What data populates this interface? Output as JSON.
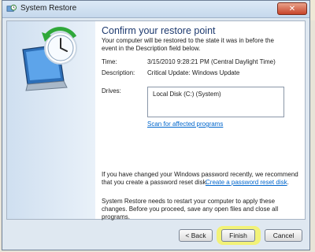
{
  "window": {
    "title": "System Restore",
    "close_glyph": "✕"
  },
  "page": {
    "heading": "Confirm your restore point",
    "intro": "Your computer will be restored to the state it was in before the event in the Description field below.",
    "time_label": "Time:",
    "time_value": "3/15/2010 9:28:21 PM (Central Daylight Time)",
    "description_label": "Description:",
    "description_value": "Critical Update: Windows Update",
    "drives_label": "Drives:",
    "drives": [
      "Local Disk (C:) (System)"
    ],
    "scan_link": "Scan for affected programs",
    "password_text": "If you have changed your Windows password recently, we recommend that you create a password reset disk.",
    "password_link": "Create a password reset disk",
    "password_end": ".",
    "restart_text": "System Restore needs to restart your computer to apply these changes. Before you proceed, save any open files and close all programs."
  },
  "buttons": {
    "back": "< Back",
    "finish": "Finish",
    "cancel": "Cancel"
  },
  "colors": {
    "accent_heading": "#1e3a6f",
    "link": "#0066cc",
    "highlight": "#f4f36a"
  },
  "icons": {
    "title": "system-restore-icon",
    "hero": "restore-clock-monitor-icon"
  }
}
